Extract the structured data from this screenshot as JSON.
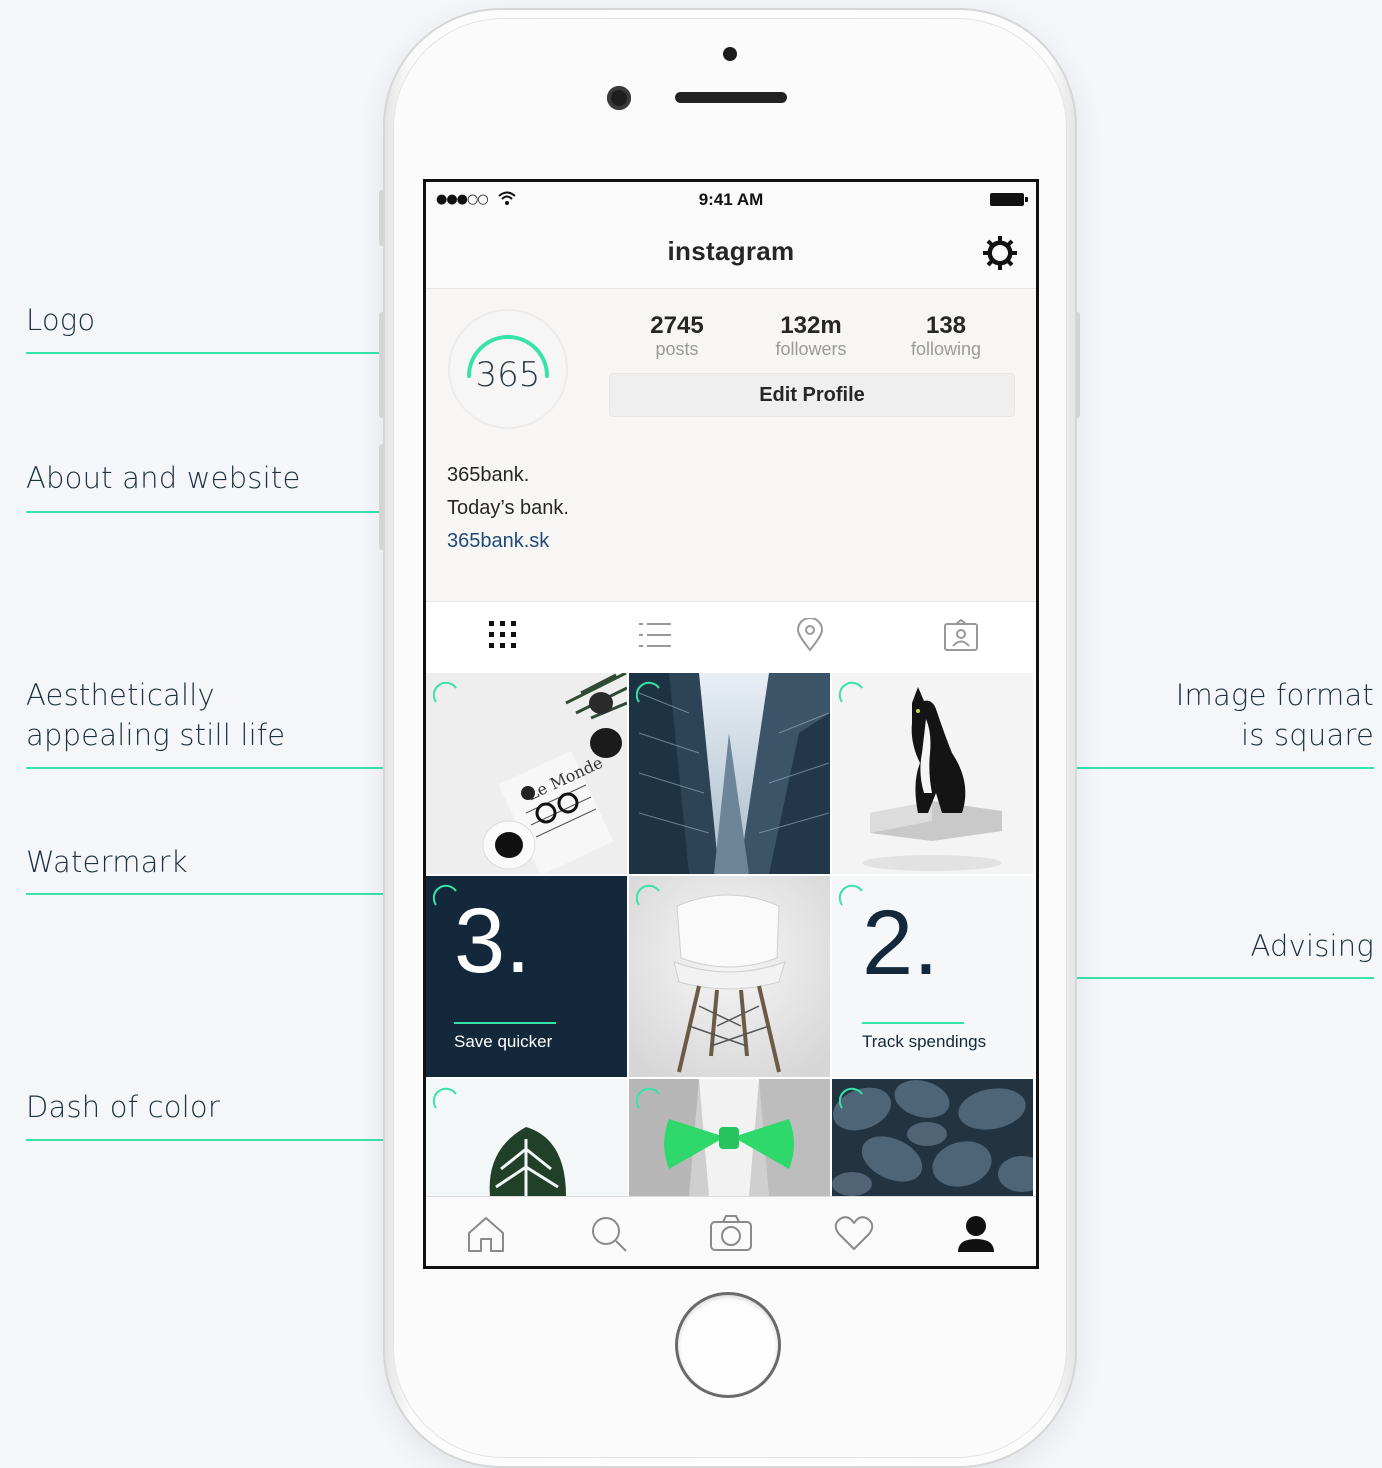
{
  "annotations": {
    "logo": "Logo",
    "about": "About and website",
    "still_life_1": "Aesthetically",
    "still_life_2": "appealing still life",
    "watermark": "Watermark",
    "dash": "Dash of color",
    "format_1": "Image format",
    "format_2": "is square",
    "advising": "Advising"
  },
  "status_bar": {
    "signal": "●●●○○",
    "time": "9:41 AM"
  },
  "nav": {
    "title": "instagram",
    "settings_icon": "gear-icon"
  },
  "profile": {
    "avatar_text": "365",
    "stats": [
      {
        "value": "2745",
        "label": "posts"
      },
      {
        "value": "132m",
        "label": "followers"
      },
      {
        "value": "138",
        "label": "following"
      }
    ],
    "edit_button": "Edit Profile",
    "bio_line_1": "365bank.",
    "bio_line_2": "Today’s bank.",
    "website": "365bank.sk"
  },
  "profile_tabs": [
    "grid-icon",
    "list-icon",
    "location-pin-icon",
    "tagged-icon"
  ],
  "grid": {
    "tile_3_number": "3.",
    "tile_3_caption": "Save quicker",
    "tile_2_number": "2.",
    "tile_2_caption": "Track spendings"
  },
  "tab_bar": [
    "home-icon",
    "search-icon",
    "camera-icon",
    "heart-icon",
    "profile-icon"
  ],
  "colors": {
    "accent": "#38e3a8",
    "navy": "#13293b",
    "link": "#1f4a7a"
  }
}
